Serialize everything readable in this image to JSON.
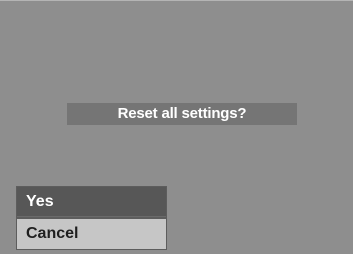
{
  "dialog": {
    "prompt": "Reset all settings?"
  },
  "menu": {
    "items": [
      {
        "label": "Yes",
        "selected": false
      },
      {
        "label": "Cancel",
        "selected": true
      }
    ]
  },
  "colors": {
    "screen_background": "#8e8e8e",
    "prompt_background": "#757575",
    "menu_item_background": "#575757",
    "menu_item_highlight": "#c6c6c6"
  }
}
